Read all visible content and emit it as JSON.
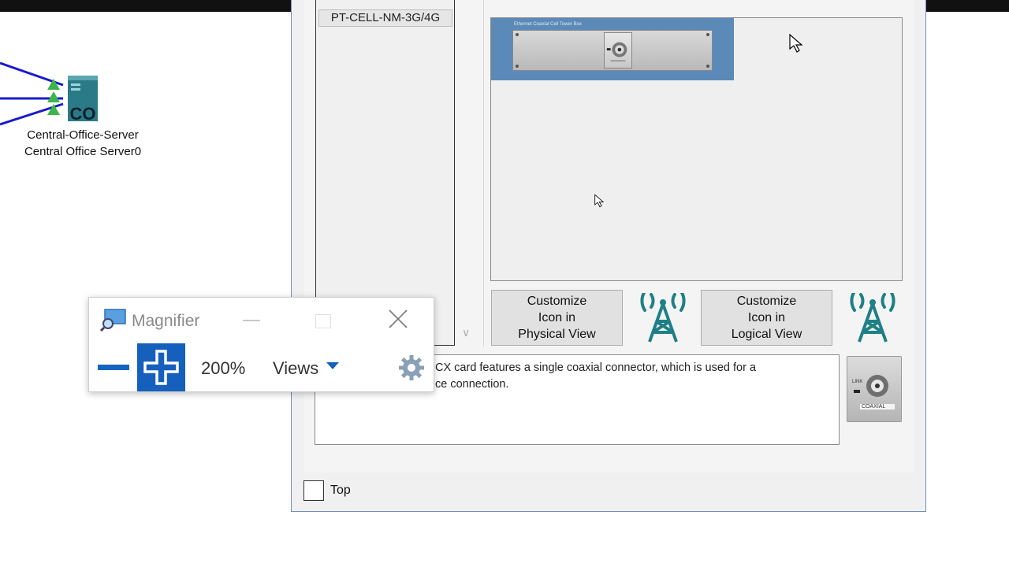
{
  "canvas": {
    "device_type": "Central-Office-Server",
    "device_name": "Central Office Server0",
    "device_badge": "CO"
  },
  "dialog": {
    "module_list": [
      "PT-CELL-NM-3G/4G"
    ],
    "module_panel_title": "Ethernet Coaxial Cell Tower Box",
    "customize_physical": "Customize\nIcon in\nPhysical View",
    "customize_logical": "Customize\nIcon in\nLogical View",
    "description_line1": "CX card features a single coaxial connector, which is used for a",
    "description_line2": "ce connection.",
    "thumb_label_top": "LINK",
    "thumb_label": "COAXIAL",
    "top_checkbox_label": "Top"
  },
  "magnifier": {
    "title": "Magnifier",
    "zoom_level": "200%",
    "views_label": "Views"
  },
  "colors": {
    "accent_blue": "#1560bd",
    "module_panel": "#5b8ab8",
    "tower_teal": "#1f7f86"
  }
}
